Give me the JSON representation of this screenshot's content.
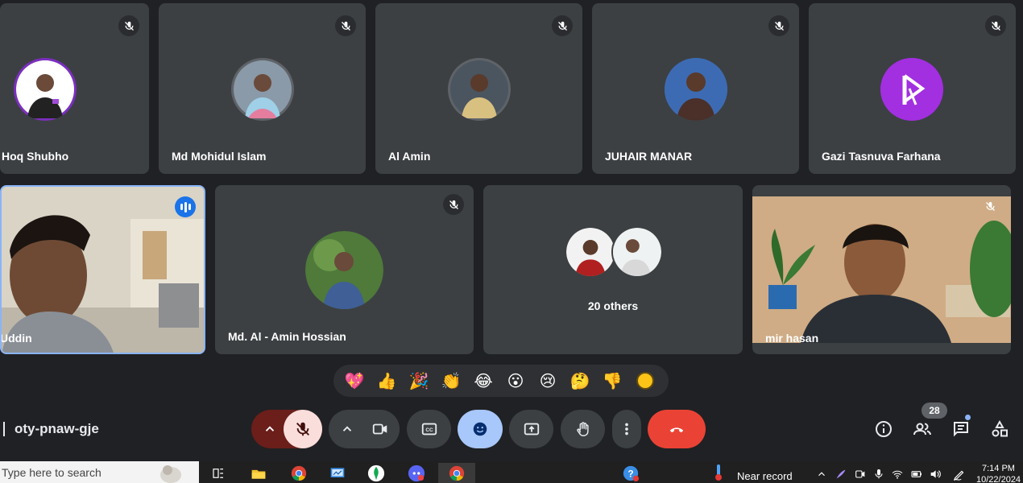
{
  "meeting": {
    "code": "oty-pnaw-gje"
  },
  "participants": [
    {
      "name": "Hoq Shubho"
    },
    {
      "name": "Md Mohidul Islam"
    },
    {
      "name": "Al Amin"
    },
    {
      "name": "JUHAIR MANAR"
    },
    {
      "name": "Gazi Tasnuva Farhana"
    },
    {
      "name": "Uddin"
    },
    {
      "name": "Md. Al - Amin Hossian"
    },
    {
      "name": "mir hasan"
    }
  ],
  "others": {
    "label": "20 others"
  },
  "reactions": [
    "💖",
    "👍",
    "🎉",
    "👏",
    "😂",
    "😮",
    "😢",
    "🤔",
    "👎"
  ],
  "people_count": "28",
  "taskbar": {
    "search_placeholder": "Type here to search",
    "weather": "Near record",
    "time": "7:14 PM",
    "date": "10/22/2024"
  },
  "colors": {
    "end_call": "#ea4335",
    "accent": "#8ab4f8",
    "active_speaker": "#8ab4f8"
  }
}
